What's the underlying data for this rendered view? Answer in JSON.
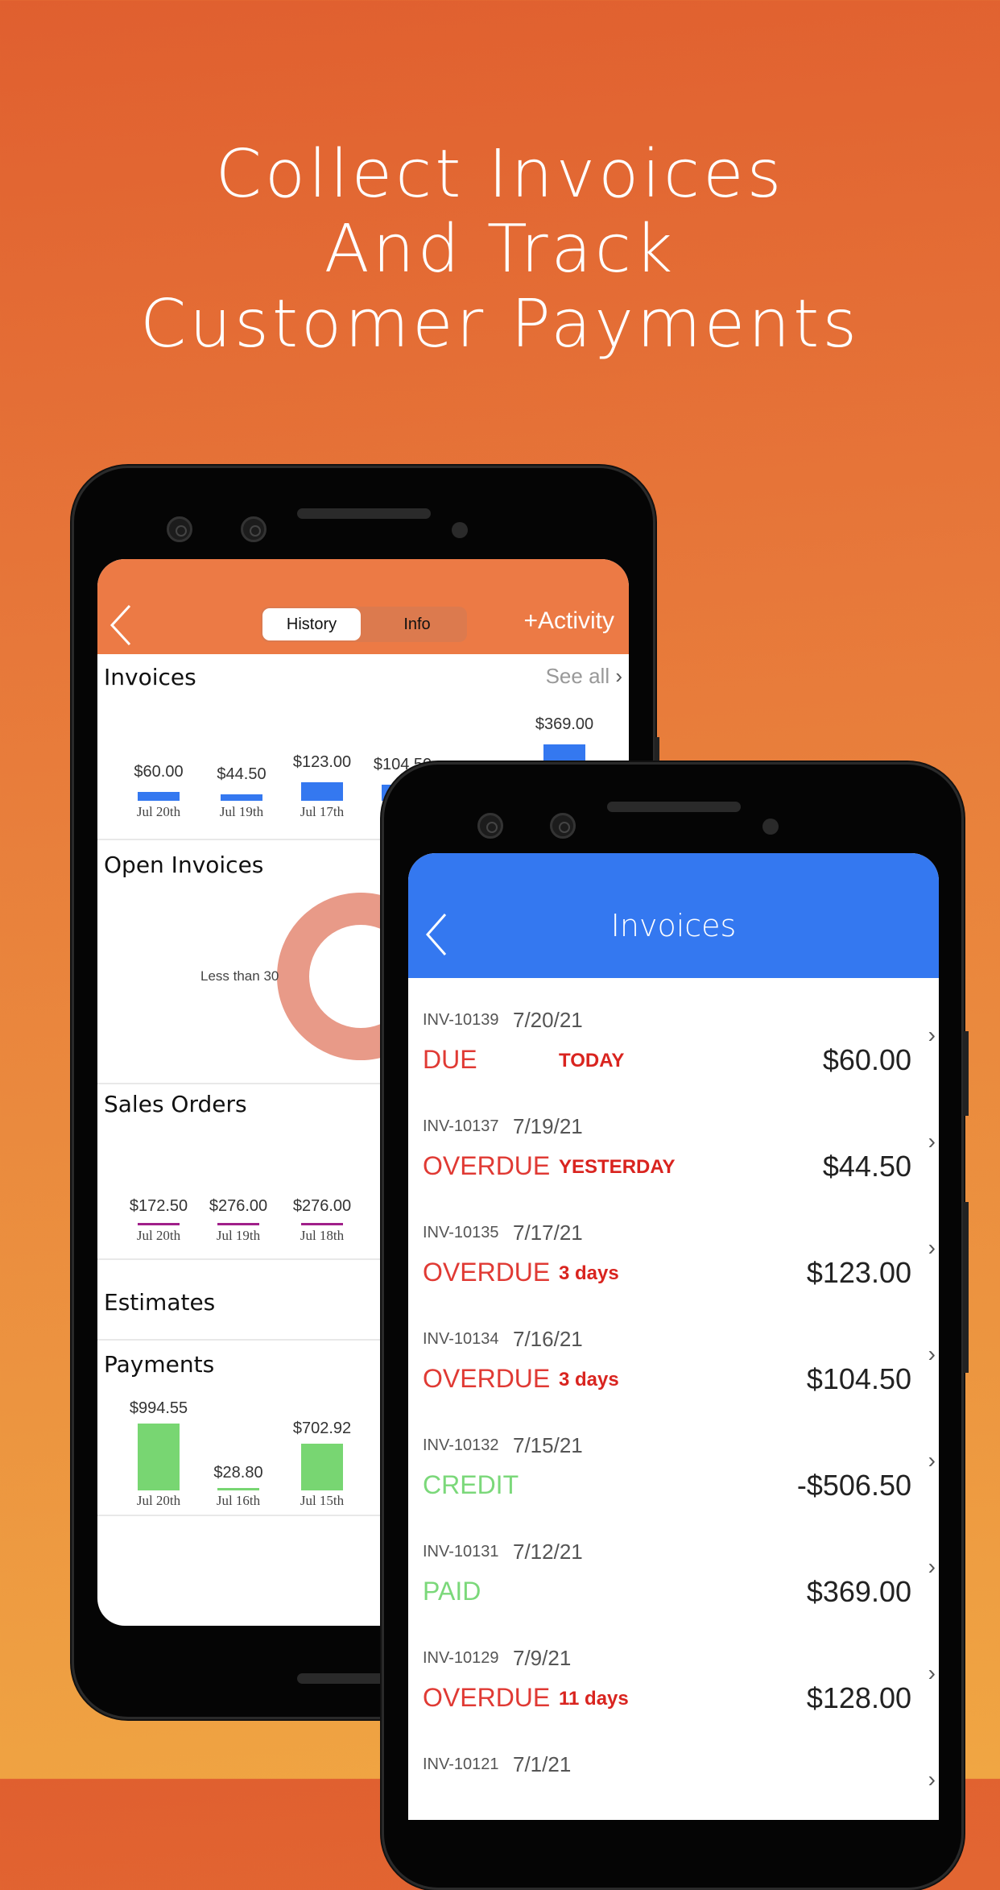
{
  "headline": [
    "Collect Invoices",
    "And Track",
    "Customer Payments"
  ],
  "colors": {
    "accent_orange": "#ec7a45",
    "accent_blue": "#3478f0",
    "invoice_bar": "#3478f0",
    "sales_line": "#a0208a",
    "payment_bar": "#78d672",
    "donut": "#e89a88",
    "overdue": "#e03a34",
    "credit": "#7bd87a"
  },
  "left_phone": {
    "back_icon": "chevron-left-icon",
    "tabs": [
      {
        "label": "History",
        "selected": true
      },
      {
        "label": "Info",
        "selected": false
      }
    ],
    "add_activity": "+Activity",
    "invoices": {
      "title": "Invoices",
      "see_all": "See all"
    },
    "open_invoices": {
      "title": "Open Invoices",
      "donut_label": "Less than 30"
    },
    "sales_orders": {
      "title": "Sales Orders"
    },
    "estimates": {
      "title": "Estimates"
    },
    "payments": {
      "title": "Payments"
    }
  },
  "chart_data": [
    {
      "type": "bar",
      "title": "Invoices",
      "categories": [
        "Jul 20th",
        "Jul 19th",
        "Jul 17th",
        "",
        ""
      ],
      "values": [
        60.0,
        44.5,
        123.0,
        104.5,
        369.0
      ],
      "labels": [
        "$60.00",
        "$44.50",
        "$123.00",
        "$104.50",
        "$369.00"
      ]
    },
    {
      "type": "pie",
      "title": "Open Invoices",
      "slices": [
        {
          "label": "Less than 30",
          "value": 100
        }
      ]
    },
    {
      "type": "bar",
      "title": "Sales Orders",
      "categories": [
        "Jul 20th",
        "Jul 19th",
        "Jul 18th"
      ],
      "values": [
        172.5,
        276.0,
        276.0
      ],
      "labels": [
        "$172.50",
        "$276.00",
        "$276.00"
      ]
    },
    {
      "type": "bar",
      "title": "Payments",
      "categories": [
        "Jul 20th",
        "Jul 16th",
        "Jul 15th"
      ],
      "values": [
        994.55,
        28.8,
        702.92
      ],
      "labels": [
        "$994.55",
        "$28.80",
        "$702.92"
      ]
    }
  ],
  "right_phone": {
    "title": "Invoices",
    "back_icon": "chevron-left-icon",
    "invoices": [
      {
        "id": "INV-10139",
        "date": "7/20/21",
        "status": "DUE",
        "detail": "TODAY",
        "amount": "$60.00",
        "kind": "due"
      },
      {
        "id": "INV-10137",
        "date": "7/19/21",
        "status": "OVERDUE",
        "detail": "YESTERDAY",
        "amount": "$44.50",
        "kind": "overdue"
      },
      {
        "id": "INV-10135",
        "date": "7/17/21",
        "status": "OVERDUE",
        "detail": "3 days",
        "amount": "$123.00",
        "kind": "overdue"
      },
      {
        "id": "INV-10134",
        "date": "7/16/21",
        "status": "OVERDUE",
        "detail": "3 days",
        "amount": "$104.50",
        "kind": "overdue"
      },
      {
        "id": "INV-10132",
        "date": "7/15/21",
        "status": "CREDIT",
        "detail": "",
        "amount": "-$506.50",
        "kind": "credit"
      },
      {
        "id": "INV-10131",
        "date": "7/12/21",
        "status": "PAID",
        "detail": "",
        "amount": "$369.00",
        "kind": "paid"
      },
      {
        "id": "INV-10129",
        "date": "7/9/21",
        "status": "OVERDUE",
        "detail": "11 days",
        "amount": "$128.00",
        "kind": "overdue"
      },
      {
        "id": "INV-10121",
        "date": "7/1/21",
        "status": "",
        "detail": "",
        "amount": "",
        "kind": ""
      }
    ]
  }
}
